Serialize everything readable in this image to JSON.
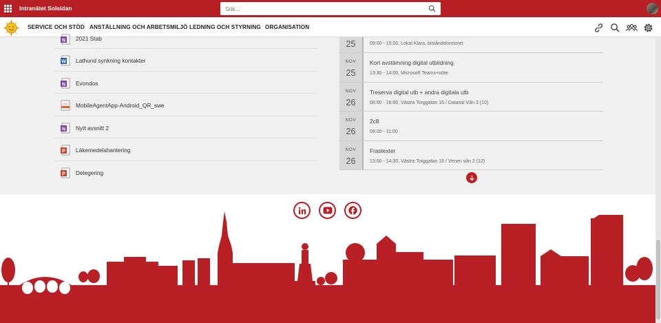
{
  "header": {
    "site_title": "Intranätet Solsidan",
    "search_placeholder": "Sök..."
  },
  "nav": {
    "items": [
      "SERVICE OCH STÖD",
      "ANSTÄLLNING OCH ARBETSMILJÖ",
      "LEDNING OCH STYRNING",
      "ORGANISATION"
    ],
    "icons": [
      "link-icon",
      "search-icon",
      "people-icon",
      "settings-icon"
    ]
  },
  "files": [
    {
      "label": "2021 Stab",
      "type": "onenote"
    },
    {
      "label": "Lathund synkning kontakter",
      "type": "word"
    },
    {
      "label": "Evondos",
      "type": "onenote"
    },
    {
      "label": "MobileAgentApp-Android_QR_swe",
      "type": "image"
    },
    {
      "label": "Nytt avsnitt 2",
      "type": "onenote"
    },
    {
      "label": "Läkemedelshantering",
      "type": "powerpoint"
    },
    {
      "label": "Delegering",
      "type": "powerpoint"
    }
  ],
  "events": [
    {
      "month": "",
      "day": "25",
      "title": "",
      "desc": "09:00 - 15:00, Lokal Klara, biståndskontoret"
    },
    {
      "month": "NOV",
      "day": "25",
      "title": "Kort avstämning digital utbildning",
      "desc": "13:30 - 14:00, Microsoft Teams-möte"
    },
    {
      "month": "NOV",
      "day": "26",
      "title": "Treserva digital utb + andra digitala utb",
      "desc": "08:00 - 16:00, Västra Torggatan 16 / Datasal Vån 3 (10)"
    },
    {
      "month": "NOV",
      "day": "26",
      "title": "2c8",
      "desc": "09:00 - 11:00"
    },
    {
      "month": "NOV",
      "day": "26",
      "title": "Frastexter",
      "desc": "13:00 - 14:30, Västra Torggatan 16 / Venen vån 2 (12)"
    }
  ],
  "social": [
    "linkedin-icon",
    "youtube-icon",
    "facebook-icon"
  ],
  "colors": {
    "brand_red": "#b92025",
    "page_bg": "#f0f0f0"
  }
}
